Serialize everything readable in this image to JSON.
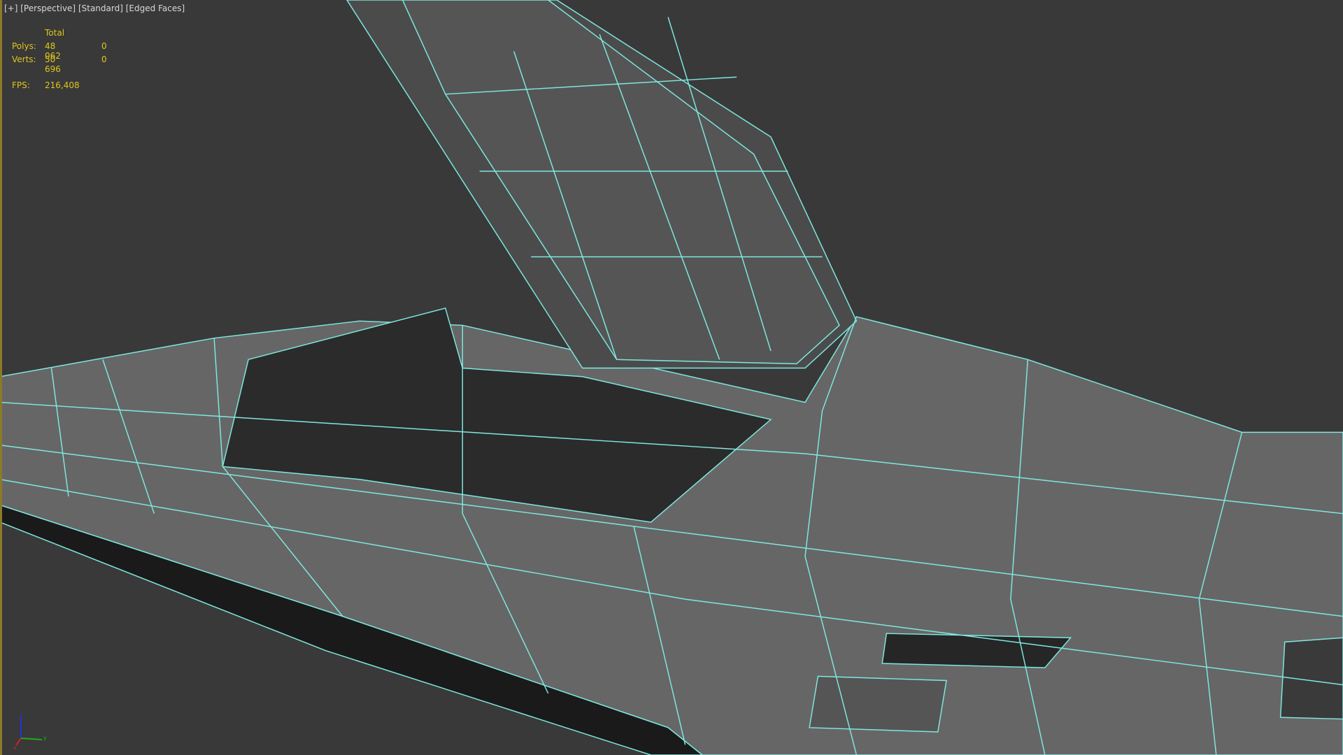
{
  "viewport": {
    "menu_plus": "[+]",
    "view_mode": "[Perspective]",
    "shading": "[Standard]",
    "display": "[Edged Faces]"
  },
  "stats": {
    "header": "Total",
    "polys_label": "Polys:",
    "polys_total": "48 062",
    "polys_selected": "0",
    "verts_label": "Verts:",
    "verts_total": "50 696",
    "verts_selected": "0",
    "fps_label": "FPS:",
    "fps_value": "216,408"
  },
  "axis_gizmo": {
    "z": "z",
    "y": "y",
    "x": "x"
  },
  "colors": {
    "background": "#393939",
    "wire": "#7fe8e0",
    "mesh": "#6b6b6b",
    "stats_text": "#e0c61a"
  }
}
